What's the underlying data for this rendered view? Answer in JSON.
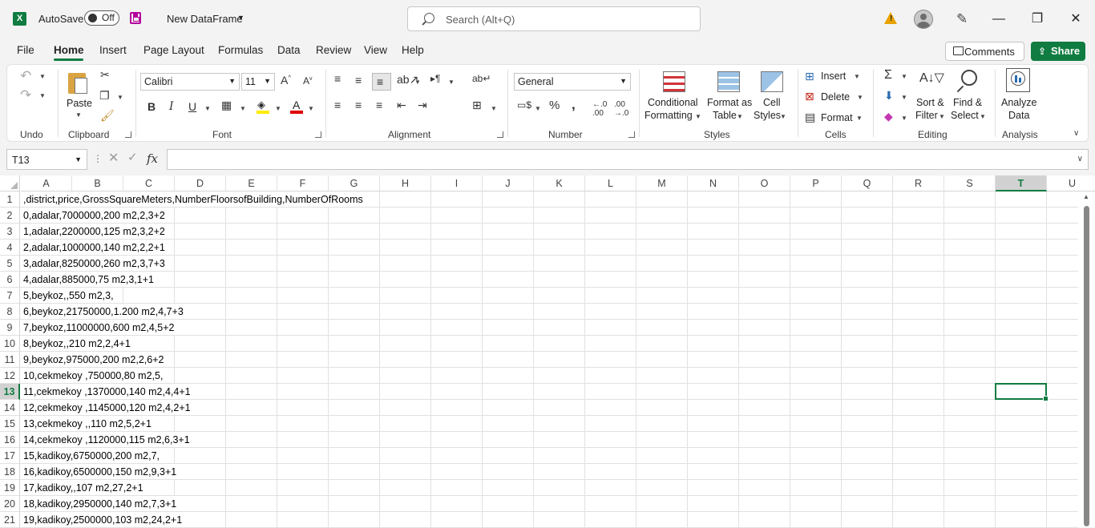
{
  "titlebar": {
    "autosave_label": "AutoSave",
    "autosave_state": "Off",
    "doc_title": "New DataFrame",
    "search_placeholder": "Search (Alt+Q)"
  },
  "menu": {
    "tabs": [
      "File",
      "Home",
      "Insert",
      "Page Layout",
      "Formulas",
      "Data",
      "Review",
      "View",
      "Help"
    ],
    "active_tab": "Home",
    "comments_label": "Comments",
    "share_label": "Share"
  },
  "ribbon": {
    "undo_group": "Undo",
    "clipboard": {
      "label": "Clipboard",
      "paste": "Paste"
    },
    "font": {
      "label": "Font",
      "name": "Calibri",
      "size": "11"
    },
    "alignment": {
      "label": "Alignment"
    },
    "number": {
      "label": "Number",
      "format": "General"
    },
    "styles": {
      "label": "Styles",
      "conditional_1": "Conditional",
      "conditional_2": "Formatting",
      "format_table_1": "Format as",
      "format_table_2": "Table",
      "cell_styles_1": "Cell",
      "cell_styles_2": "Styles"
    },
    "cells": {
      "label": "Cells",
      "insert": "Insert",
      "delete": "Delete",
      "format": "Format"
    },
    "editing": {
      "label": "Editing",
      "sort_1": "Sort &",
      "sort_2": "Filter",
      "find_1": "Find &",
      "find_2": "Select"
    },
    "analysis": {
      "label": "Analysis",
      "analyze_1": "Analyze",
      "analyze_2": "Data"
    }
  },
  "formula_bar": {
    "name_box": "T13",
    "formula": ""
  },
  "accent": "#107c41",
  "sheet": {
    "columns": [
      "A",
      "B",
      "C",
      "D",
      "E",
      "F",
      "G",
      "H",
      "I",
      "J",
      "K",
      "L",
      "M",
      "N",
      "O",
      "P",
      "Q",
      "R",
      "S",
      "T",
      "U"
    ],
    "selected_column": "T",
    "selected_row": 13,
    "rows": [
      {
        "n": 1,
        "text": ",district,price,GrossSquareMeters,NumberFloorsofBuilding,NumberOfRooms"
      },
      {
        "n": 2,
        "text": "0,adalar,7000000,200 m2,2,3+2"
      },
      {
        "n": 3,
        "text": "1,adalar,2200000,125 m2,3,2+2"
      },
      {
        "n": 4,
        "text": "2,adalar,1000000,140 m2,2,2+1"
      },
      {
        "n": 5,
        "text": "3,adalar,8250000,260 m2,3,7+3"
      },
      {
        "n": 6,
        "text": "4,adalar,885000,75 m2,3,1+1"
      },
      {
        "n": 7,
        "text": "5,beykoz,,550 m2,3,"
      },
      {
        "n": 8,
        "text": "6,beykoz,21750000,1.200 m2,4,7+3"
      },
      {
        "n": 9,
        "text": "7,beykoz,11000000,600 m2,4,5+2"
      },
      {
        "n": 10,
        "text": "8,beykoz,,210 m2,2,4+1"
      },
      {
        "n": 11,
        "text": "9,beykoz,975000,200 m2,2,6+2"
      },
      {
        "n": 12,
        "text": "10,cekmekoy ,750000,80 m2,5,"
      },
      {
        "n": 13,
        "text": "11,cekmekoy ,1370000,140 m2,4,4+1"
      },
      {
        "n": 14,
        "text": "12,cekmekoy ,1145000,120 m2,4,2+1"
      },
      {
        "n": 15,
        "text": "13,cekmekoy ,,110 m2,5,2+1"
      },
      {
        "n": 16,
        "text": "14,cekmekoy ,1120000,115 m2,6,3+1"
      },
      {
        "n": 17,
        "text": "15,kadikoy,6750000,200 m2,7,"
      },
      {
        "n": 18,
        "text": "16,kadikoy,6500000,150 m2,9,3+1"
      },
      {
        "n": 19,
        "text": "17,kadikoy,,107 m2,27,2+1"
      },
      {
        "n": 20,
        "text": "18,kadikoy,2950000,140 m2,7,3+1"
      },
      {
        "n": 21,
        "text": "19,kadikoy,2500000,103 m2,24,2+1"
      }
    ]
  }
}
